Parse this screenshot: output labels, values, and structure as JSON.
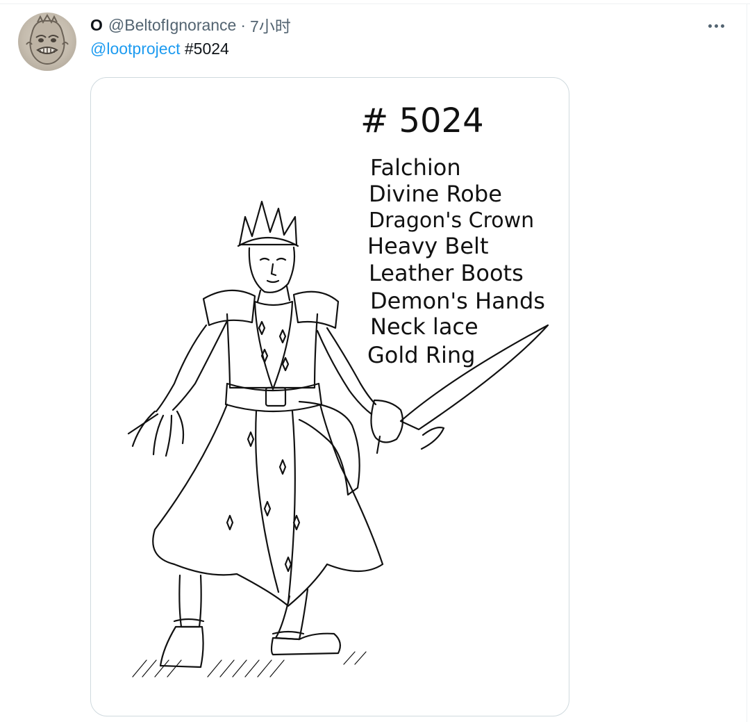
{
  "tweet": {
    "display_name": "O",
    "handle": "@BeltofIgnorance",
    "separator": "·",
    "time": "7小时",
    "text": {
      "mention": "@lootproject",
      "hashtag": "#5024"
    },
    "more_icon": "more-horizontal-icon"
  },
  "media": {
    "number": "# 5024",
    "items": [
      "Falchion",
      "Divine Robe",
      "Dragon's Crown",
      "Heavy Belt",
      "Leather Boots",
      "Demon's Hands",
      "Neck lace",
      "Gold Ring"
    ]
  },
  "colors": {
    "link": "#1d9bf0",
    "text": "#0f1419",
    "muted": "#536471",
    "border": "#cfd9de"
  }
}
